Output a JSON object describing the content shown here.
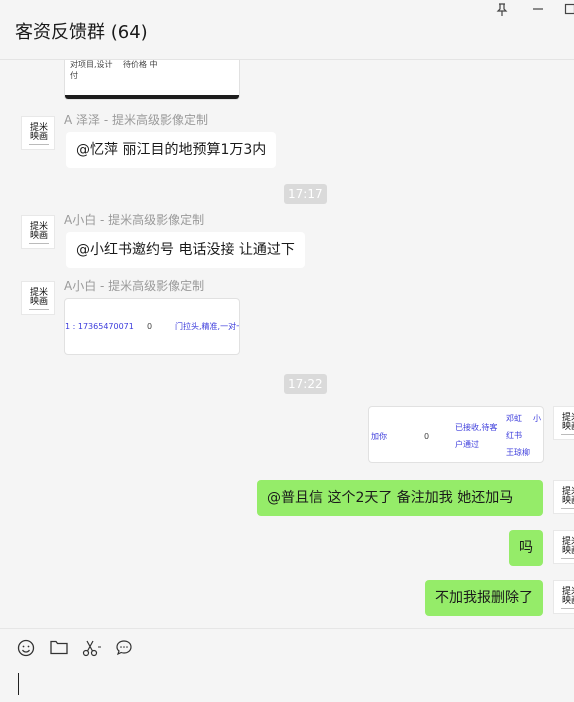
{
  "window": {
    "title": "客资反馈群 (64)",
    "pin_icon": "pin-icon",
    "minimize_icon": "minimize-icon",
    "maximize_icon": "maximize-icon"
  },
  "avatar": {
    "brand_top": "提米",
    "brand_bottom": "映画"
  },
  "messages": {
    "m1": {
      "sender": "A 泽泽 - 提米高级影像定制",
      "text": "@忆萍 丽江目的地预算1万3内"
    },
    "time1": "17:17",
    "m2": {
      "sender": "A小白 - 提米高级影像定制",
      "text": "@小红书邀约号  电话没接 让通过下"
    },
    "m3": {
      "sender": "A小白 - 提米高级影像定制",
      "card": {
        "phone": "1 : 17365470071",
        "zero": "0",
        "note": "门拉头,精准,一对一"
      }
    },
    "time2": "17:22",
    "m4": {
      "card": {
        "c1": "加你",
        "c2": "0",
        "c3a": "已接收,待客",
        "c3b": "户通过",
        "c4a": "邓虹",
        "c4b": "红书",
        "c4c": "王琼柳",
        "c5": "小"
      }
    },
    "m5": {
      "text": "@普且信    这个2天了    备注加我    她还加马"
    },
    "m6": {
      "text": "吗"
    },
    "m7": {
      "text": "不加我报删除了"
    },
    "top_card": {
      "line1": "对项目,设计",
      "line2": "付",
      "line3": "待价格 中"
    }
  },
  "toolbar": {
    "emoji_icon": "emoji-icon",
    "folder_icon": "folder-icon",
    "scissors_icon": "scissors-icon",
    "chat_icon": "chat-bubble-icon"
  }
}
